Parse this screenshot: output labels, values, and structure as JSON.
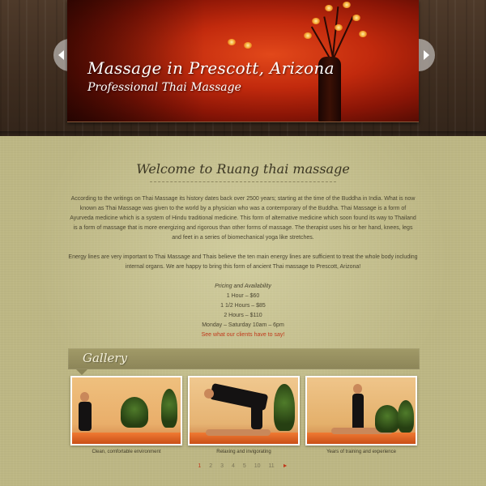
{
  "slider": {
    "title": "Massage in Prescott, Arizona",
    "subtitle": "Professional Thai Massage",
    "prev_icon": "chevron-left-icon",
    "next_icon": "chevron-right-icon"
  },
  "welcome": {
    "heading": "Welcome to Ruang thai massage",
    "paragraph1": "According to the writings on Thai Massage its history dates back over 2500 years; starting at the time of the Buddha in India. What is now known as Thai Massage was given to the world by a physician who was a contemporary of the Buddha. Thai Massage is a form of Ayurveda medicine which is a system of Hindu traditional medicine. This form of alternative medicine which soon found its way to Thailand is a form of massage that is more energizing and rigorous than other forms of massage. The therapist uses his or her hand, knees, legs and feet in a series of biomechanical yoga like stretches.",
    "paragraph2": "Energy lines are very important to Thai Massage and Thais believe the ten main energy lines are sufficient to treat the whole body including internal organs. We are happy to bring this form of ancient Thai massage to Prescott, Arizona!"
  },
  "pricing": {
    "heading": "Pricing and Availability",
    "lines": [
      "1 Hour – $60",
      "1 1/2 Hours – $85",
      "2 Hours – $110",
      "Monday – Saturday 10am – 6pm"
    ],
    "link": "See what our clients have to say!",
    "link_color": "#c0391b"
  },
  "gallery": {
    "title": "Gallery",
    "items": [
      {
        "caption": "Clean, comfortable environment"
      },
      {
        "caption": "Relaxing and invigorating"
      },
      {
        "caption": "Years of training and experience"
      }
    ],
    "pages": [
      "1",
      "2",
      "3",
      "4",
      "5",
      "10",
      "11",
      "►"
    ],
    "current_page": "1"
  },
  "colors": {
    "wood": "#3d2c1f",
    "parchment": "#bdb784",
    "gallery_bar": "#8c8558",
    "accent": "#c0391b"
  }
}
